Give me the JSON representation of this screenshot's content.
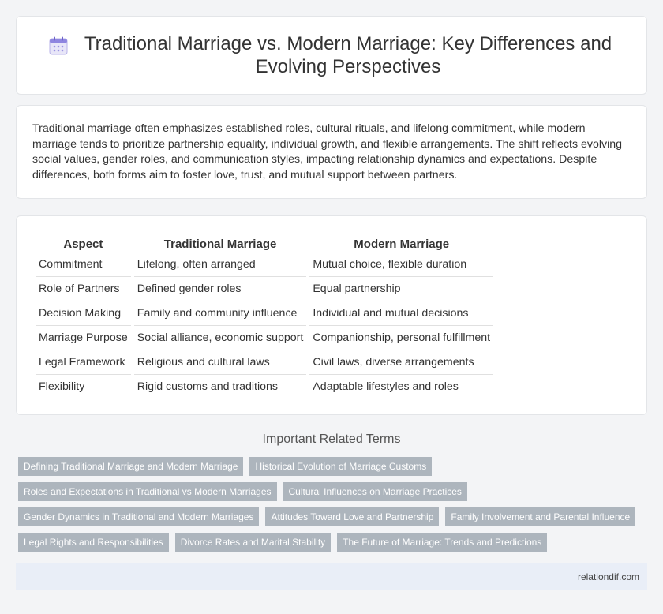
{
  "header": {
    "icon": "calendar-icon",
    "title": "Traditional Marriage vs. Modern Marriage: Key Differences and Evolving Perspectives"
  },
  "intro": {
    "text": "Traditional marriage often emphasizes established roles, cultural rituals, and lifelong commitment, while modern marriage tends to prioritize partnership equality, individual growth, and flexible arrangements. The shift reflects evolving social values, gender roles, and communication styles, impacting relationship dynamics and expectations. Despite differences, both forms aim to foster love, trust, and mutual support between partners."
  },
  "table": {
    "headers": [
      "Aspect",
      "Traditional Marriage",
      "Modern Marriage"
    ],
    "rows": [
      [
        "Commitment",
        "Lifelong, often arranged",
        "Mutual choice, flexible duration"
      ],
      [
        "Role of Partners",
        "Defined gender roles",
        "Equal partnership"
      ],
      [
        "Decision Making",
        "Family and community influence",
        "Individual and mutual decisions"
      ],
      [
        "Marriage Purpose",
        "Social alliance, economic support",
        "Companionship, personal fulfillment"
      ],
      [
        "Legal Framework",
        "Religious and cultural laws",
        "Civil laws, diverse arrangements"
      ],
      [
        "Flexibility",
        "Rigid customs and traditions",
        "Adaptable lifestyles and roles"
      ]
    ]
  },
  "related": {
    "title": "Important Related Terms",
    "rows": [
      [
        "Defining Traditional Marriage and Modern Marriage",
        "Historical Evolution of Marriage Customs"
      ],
      [
        "Roles and Expectations in Traditional vs Modern Marriages",
        "Cultural Influences on Marriage Practices"
      ],
      [
        "Gender Dynamics in Traditional and Modern Marriages",
        "Attitudes Toward Love and Partnership",
        "Family Involvement and Parental Influence"
      ],
      [
        "Legal Rights and Responsibilities",
        "Divorce Rates and Marital Stability",
        "The Future of Marriage: Trends and Predictions"
      ]
    ]
  },
  "footer": {
    "site": "relationdif.com"
  }
}
